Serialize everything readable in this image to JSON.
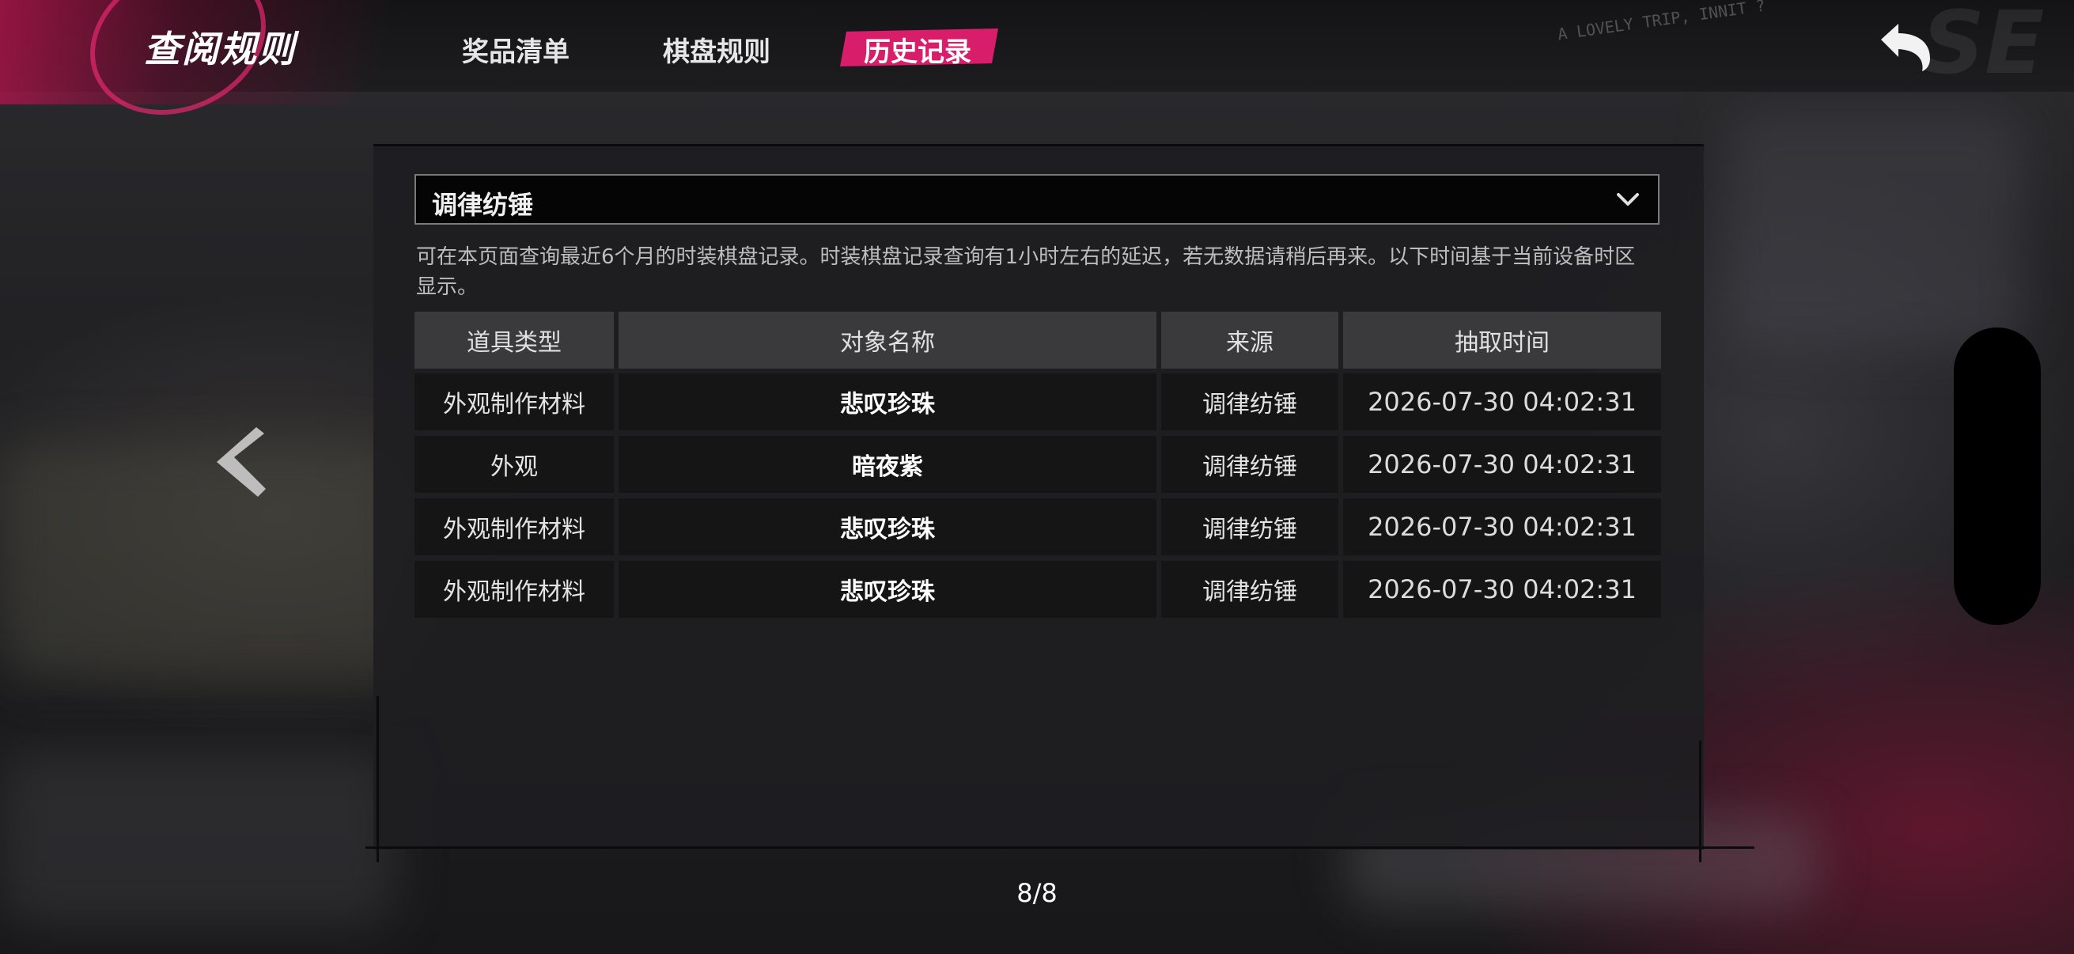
{
  "header": {
    "title": "查阅规则",
    "tabs": [
      {
        "label": "奖品清单",
        "active": false
      },
      {
        "label": "棋盘规则",
        "active": false
      },
      {
        "label": "历史记录",
        "active": true
      }
    ],
    "decor_text": "A LOVELY TRIP, INNIT ?",
    "back_icon": "undo-arrow-icon",
    "accent_color": "#d81d6a"
  },
  "filter": {
    "selected": "调律纺锤",
    "icon": "chevron-down-icon"
  },
  "notice": "可在本页面查询最近6个月的时装棋盘记录。时装棋盘记录查询有1小时左右的延迟，若无数据请稍后再来。以下时间基于当前设备时区显示。",
  "table": {
    "headers": [
      "道具类型",
      "对象名称",
      "来源",
      "抽取时间"
    ],
    "rows": [
      {
        "type": "外观制作材料",
        "name": "悲叹珍珠",
        "source": "调律纺锤",
        "time": "2026-07-30 04:02:31"
      },
      {
        "type": "外观",
        "name": "暗夜紫",
        "source": "调律纺锤",
        "time": "2026-07-30 04:02:31"
      },
      {
        "type": "外观制作材料",
        "name": "悲叹珍珠",
        "source": "调律纺锤",
        "time": "2026-07-30 04:02:31"
      },
      {
        "type": "外观制作材料",
        "name": "悲叹珍珠",
        "source": "调律纺锤",
        "time": "2026-07-30 04:02:31"
      }
    ]
  },
  "pagination": {
    "current": 8,
    "total": 8,
    "label": "8/8",
    "prev_icon": "chevron-left-icon"
  }
}
